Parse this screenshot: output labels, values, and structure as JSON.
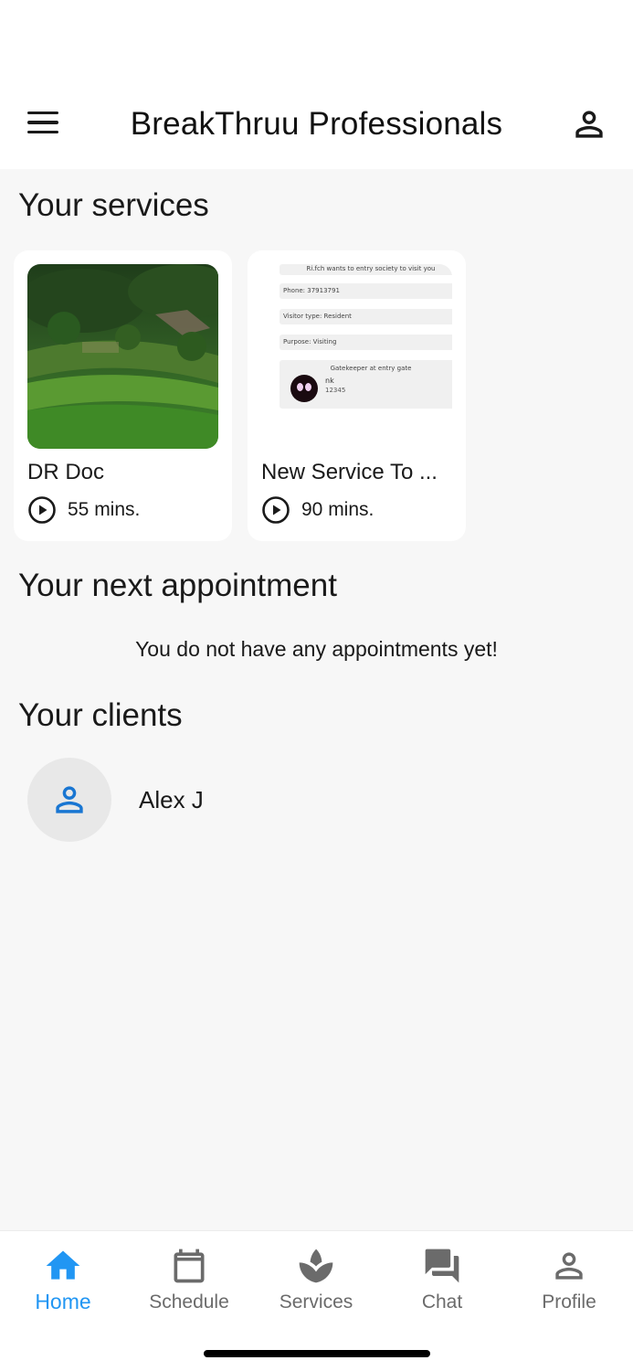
{
  "header": {
    "title": "BreakThruu Professionals"
  },
  "services": {
    "title": "Your services",
    "items": [
      {
        "name": "DR Doc",
        "duration": "55 mins."
      },
      {
        "name": "New Service To ...",
        "duration": "90 mins."
      }
    ],
    "screenshot_thumb": {
      "line1": "Ri.fch wants to entry society to visit you",
      "line2": "Phone: 37913791",
      "line3": "Visitor type: Resident",
      "line4": "Purpose: Visiting",
      "line5": "Gatekeeper at entry gate",
      "line6": "nk",
      "line7": "12345"
    }
  },
  "appointments": {
    "title": "Your next appointment",
    "empty_message": "You do not have any appointments yet!"
  },
  "clients": {
    "title": "Your clients",
    "items": [
      {
        "name": "Alex J"
      }
    ]
  },
  "nav": {
    "items": [
      {
        "label": "Home",
        "icon": "home-icon",
        "active": true
      },
      {
        "label": "Schedule",
        "icon": "calendar-icon"
      },
      {
        "label": "Services",
        "icon": "spa-icon"
      },
      {
        "label": "Chat",
        "icon": "chat-icon"
      },
      {
        "label": "Profile",
        "icon": "person-icon"
      }
    ]
  },
  "colors": {
    "accent": "#2196f3",
    "client_icon": "#1976d2",
    "background": "#f7f7f7"
  }
}
